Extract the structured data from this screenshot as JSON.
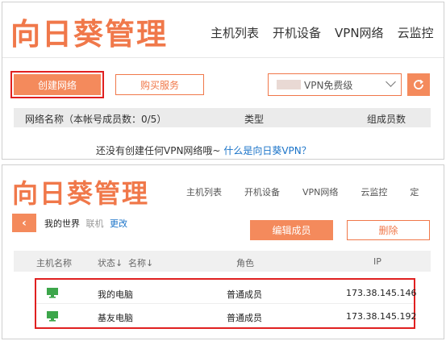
{
  "brand": "向日葵管理",
  "nav": [
    "主机列表",
    "开机设备",
    "VPN网络",
    "云监控"
  ],
  "nav_bottom": [
    "主机列表",
    "开机设备",
    "VPN网络",
    "云监控",
    "定"
  ],
  "nav_active": "VPN网络",
  "toolbar": {
    "create_label": "创建网络",
    "buy_label": "购买服务",
    "plan_label": "VPN免费级"
  },
  "network_table": {
    "columns": [
      "网络名称（本帐号成员数：0/5）",
      "类型",
      "组成员数"
    ],
    "empty_text": "还没有创建任何VPN网络哦~",
    "help_link": "什么是向日葵VPN？"
  },
  "network_detail": {
    "name": "我的世界",
    "status": "联机",
    "edit_link": "更改",
    "edit_members_label": "编辑成员",
    "delete_label": "删除"
  },
  "members_table": {
    "columns": [
      "主机名称",
      "状态↓",
      "名称↓",
      "角色",
      "IP"
    ],
    "rows": [
      {
        "name": "我的电脑",
        "role": "普通成员",
        "ip": "173.38.145.146"
      },
      {
        "name": "基友电脑",
        "role": "普通成员",
        "ip": "173.38.145.192"
      }
    ]
  },
  "colors": {
    "accent": "#f0784a",
    "highlight_box": "#e02020",
    "link": "#1a73c8",
    "online_icon": "#3ca64a"
  }
}
